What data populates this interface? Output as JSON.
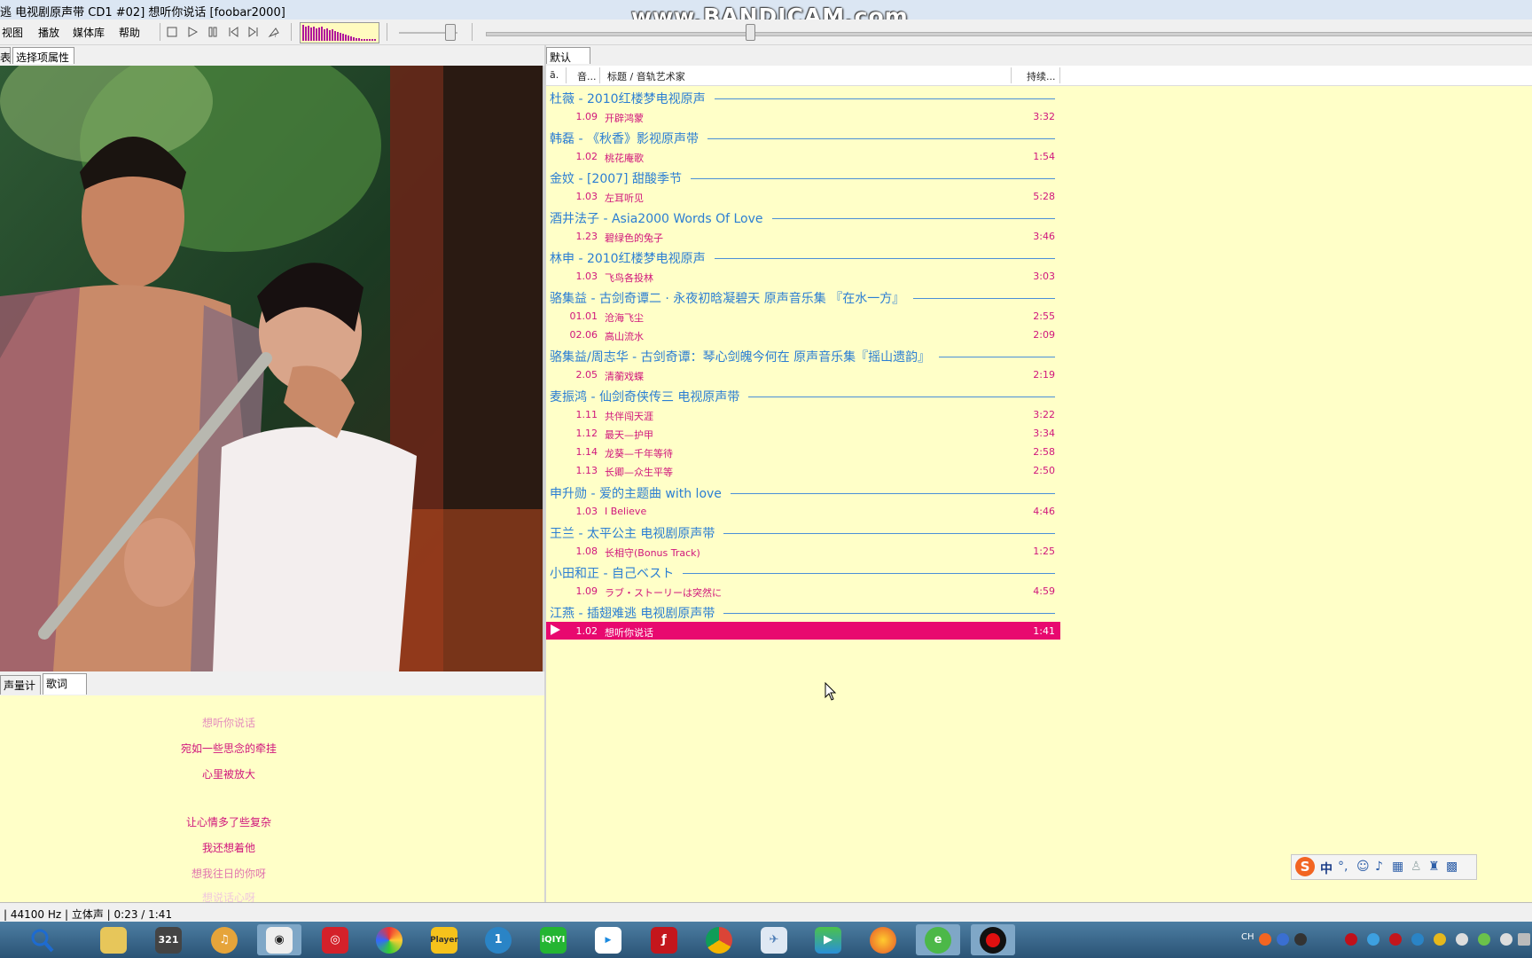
{
  "window": {
    "title": "逃 电视剧原声带 CD1 #02] 想听你说话  [foobar2000]",
    "watermark": "www.BANDICAM.com"
  },
  "menu": [
    "视图",
    "播放",
    "媒体库",
    "帮助"
  ],
  "toolbar_icons": [
    "stop-icon",
    "play-icon",
    "pause-icon",
    "previous-icon",
    "next-icon",
    "random-icon"
  ],
  "left_panel": {
    "tabs": [
      "表",
      "选择项属性"
    ],
    "bottom_tabs": [
      "声量计",
      "歌词"
    ],
    "lyrics": [
      "想听你说话",
      "宛如一些思念的牵挂",
      "心里被放大",
      "",
      "让心情多了些复杂",
      "我还想着他",
      "想我往日的你呀",
      "想说话心呀"
    ]
  },
  "playlist": {
    "tab": "默认",
    "columns": [
      "ā.",
      "音...",
      "标题 / 音轨艺术家",
      "持续..."
    ],
    "groups": [
      {
        "title": "杜薇 - 2010红楼梦电视原声",
        "tracks": [
          {
            "no": "1.09",
            "name": "开辟鸿蒙",
            "dur": "3:32"
          }
        ]
      },
      {
        "title": "韩磊 - 《秋香》影视原声带",
        "tracks": [
          {
            "no": "1.02",
            "name": "桃花庵歌",
            "dur": "1:54"
          }
        ]
      },
      {
        "title": "金妏 - [2007] 甜酸季节",
        "tracks": [
          {
            "no": "1.03",
            "name": "左耳听见",
            "dur": "5:28"
          }
        ]
      },
      {
        "title": "酒井法子 - Asia2000 Words Of Love",
        "tracks": [
          {
            "no": "1.23",
            "name": "碧绿色的兔子",
            "dur": "3:46"
          }
        ]
      },
      {
        "title": "林申 - 2010红楼梦电视原声",
        "tracks": [
          {
            "no": "1.03",
            "name": "飞鸟各投林",
            "dur": "3:03"
          }
        ]
      },
      {
        "title": "骆集益 - 古剑奇谭二 · 永夜初晗凝碧天 原声音乐集 『在水一方』",
        "tracks": [
          {
            "no": "01.01",
            "name": "沧海飞尘",
            "dur": "2:55"
          },
          {
            "no": "02.06",
            "name": "高山流水",
            "dur": "2:09"
          }
        ]
      },
      {
        "title": "骆集益/周志华 - 古剑奇谭：琴心剑魄今何在 原声音乐集『摇山遗韵』",
        "tracks": [
          {
            "no": "2.05",
            "name": "清蘅戏蝶",
            "dur": "2:19"
          }
        ]
      },
      {
        "title": "麦振鸿 - 仙剑奇侠传三 电视原声带",
        "tracks": [
          {
            "no": "1.11",
            "name": "共伴闯天涯",
            "dur": "3:22"
          },
          {
            "no": "1.12",
            "name": "最天—护甲",
            "dur": "3:34"
          },
          {
            "no": "1.14",
            "name": "龙葵—千年等待",
            "dur": "2:58"
          },
          {
            "no": "1.13",
            "name": "长卿—众生平等",
            "dur": "2:50"
          }
        ]
      },
      {
        "title": "申升勋 - 爱的主题曲 with love",
        "tracks": [
          {
            "no": "1.03",
            "name": "I Believe",
            "dur": "4:46"
          }
        ]
      },
      {
        "title": "王兰 - 太平公主 电视剧原声带",
        "tracks": [
          {
            "no": "1.08",
            "name": "长相守(Bonus Track)",
            "dur": "1:25"
          }
        ]
      },
      {
        "title": "小田和正 - 自己ベスト",
        "tracks": [
          {
            "no": "1.09",
            "name": "ラブ・ストーリーは突然に",
            "dur": "4:59"
          }
        ]
      },
      {
        "title": "江燕 - 插翅难逃 电视剧原声带",
        "tracks": [
          {
            "no": "1.02",
            "name": "想听你说话",
            "dur": "1:41",
            "playing": true
          }
        ]
      }
    ]
  },
  "status": "| 44100 Hz | 立体声 | 0:23 / 1:41",
  "ime": {
    "logo": "S",
    "mode": "中",
    "punct": "°,"
  },
  "taskbar_apps": [
    "search",
    "explorer",
    "321-player",
    "headphones",
    "alien",
    "netease-music",
    "color-app",
    "player",
    "1-app",
    "iqiyi",
    "youku",
    "flash",
    "chrome",
    "bird-app",
    "video-player",
    "firefox",
    "ie-app",
    "record-app"
  ],
  "colors": {
    "accent_pink": "#e8096f",
    "group_blue": "#2b7ed3",
    "bg_yellow": "#ffffc8"
  }
}
